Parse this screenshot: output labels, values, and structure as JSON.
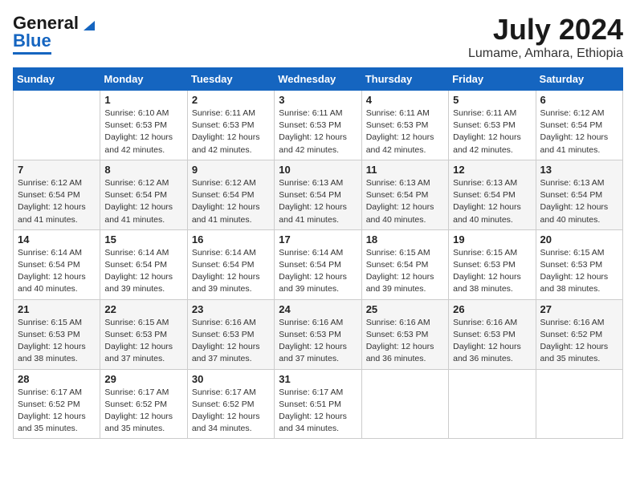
{
  "header": {
    "logo_line1": "General",
    "logo_line2": "Blue",
    "month_title": "July 2024",
    "location": "Lumame, Amhara, Ethiopia"
  },
  "days_of_week": [
    "Sunday",
    "Monday",
    "Tuesday",
    "Wednesday",
    "Thursday",
    "Friday",
    "Saturday"
  ],
  "weeks": [
    [
      {
        "day": "",
        "sunrise": "",
        "sunset": "",
        "daylight": ""
      },
      {
        "day": "1",
        "sunrise": "Sunrise: 6:10 AM",
        "sunset": "Sunset: 6:53 PM",
        "daylight": "Daylight: 12 hours and 42 minutes."
      },
      {
        "day": "2",
        "sunrise": "Sunrise: 6:11 AM",
        "sunset": "Sunset: 6:53 PM",
        "daylight": "Daylight: 12 hours and 42 minutes."
      },
      {
        "day": "3",
        "sunrise": "Sunrise: 6:11 AM",
        "sunset": "Sunset: 6:53 PM",
        "daylight": "Daylight: 12 hours and 42 minutes."
      },
      {
        "day": "4",
        "sunrise": "Sunrise: 6:11 AM",
        "sunset": "Sunset: 6:53 PM",
        "daylight": "Daylight: 12 hours and 42 minutes."
      },
      {
        "day": "5",
        "sunrise": "Sunrise: 6:11 AM",
        "sunset": "Sunset: 6:53 PM",
        "daylight": "Daylight: 12 hours and 42 minutes."
      },
      {
        "day": "6",
        "sunrise": "Sunrise: 6:12 AM",
        "sunset": "Sunset: 6:54 PM",
        "daylight": "Daylight: 12 hours and 41 minutes."
      }
    ],
    [
      {
        "day": "7",
        "sunrise": "Sunrise: 6:12 AM",
        "sunset": "Sunset: 6:54 PM",
        "daylight": "Daylight: 12 hours and 41 minutes."
      },
      {
        "day": "8",
        "sunrise": "Sunrise: 6:12 AM",
        "sunset": "Sunset: 6:54 PM",
        "daylight": "Daylight: 12 hours and 41 minutes."
      },
      {
        "day": "9",
        "sunrise": "Sunrise: 6:12 AM",
        "sunset": "Sunset: 6:54 PM",
        "daylight": "Daylight: 12 hours and 41 minutes."
      },
      {
        "day": "10",
        "sunrise": "Sunrise: 6:13 AM",
        "sunset": "Sunset: 6:54 PM",
        "daylight": "Daylight: 12 hours and 41 minutes."
      },
      {
        "day": "11",
        "sunrise": "Sunrise: 6:13 AM",
        "sunset": "Sunset: 6:54 PM",
        "daylight": "Daylight: 12 hours and 40 minutes."
      },
      {
        "day": "12",
        "sunrise": "Sunrise: 6:13 AM",
        "sunset": "Sunset: 6:54 PM",
        "daylight": "Daylight: 12 hours and 40 minutes."
      },
      {
        "day": "13",
        "sunrise": "Sunrise: 6:13 AM",
        "sunset": "Sunset: 6:54 PM",
        "daylight": "Daylight: 12 hours and 40 minutes."
      }
    ],
    [
      {
        "day": "14",
        "sunrise": "Sunrise: 6:14 AM",
        "sunset": "Sunset: 6:54 PM",
        "daylight": "Daylight: 12 hours and 40 minutes."
      },
      {
        "day": "15",
        "sunrise": "Sunrise: 6:14 AM",
        "sunset": "Sunset: 6:54 PM",
        "daylight": "Daylight: 12 hours and 39 minutes."
      },
      {
        "day": "16",
        "sunrise": "Sunrise: 6:14 AM",
        "sunset": "Sunset: 6:54 PM",
        "daylight": "Daylight: 12 hours and 39 minutes."
      },
      {
        "day": "17",
        "sunrise": "Sunrise: 6:14 AM",
        "sunset": "Sunset: 6:54 PM",
        "daylight": "Daylight: 12 hours and 39 minutes."
      },
      {
        "day": "18",
        "sunrise": "Sunrise: 6:15 AM",
        "sunset": "Sunset: 6:54 PM",
        "daylight": "Daylight: 12 hours and 39 minutes."
      },
      {
        "day": "19",
        "sunrise": "Sunrise: 6:15 AM",
        "sunset": "Sunset: 6:53 PM",
        "daylight": "Daylight: 12 hours and 38 minutes."
      },
      {
        "day": "20",
        "sunrise": "Sunrise: 6:15 AM",
        "sunset": "Sunset: 6:53 PM",
        "daylight": "Daylight: 12 hours and 38 minutes."
      }
    ],
    [
      {
        "day": "21",
        "sunrise": "Sunrise: 6:15 AM",
        "sunset": "Sunset: 6:53 PM",
        "daylight": "Daylight: 12 hours and 38 minutes."
      },
      {
        "day": "22",
        "sunrise": "Sunrise: 6:15 AM",
        "sunset": "Sunset: 6:53 PM",
        "daylight": "Daylight: 12 hours and 37 minutes."
      },
      {
        "day": "23",
        "sunrise": "Sunrise: 6:16 AM",
        "sunset": "Sunset: 6:53 PM",
        "daylight": "Daylight: 12 hours and 37 minutes."
      },
      {
        "day": "24",
        "sunrise": "Sunrise: 6:16 AM",
        "sunset": "Sunset: 6:53 PM",
        "daylight": "Daylight: 12 hours and 37 minutes."
      },
      {
        "day": "25",
        "sunrise": "Sunrise: 6:16 AM",
        "sunset": "Sunset: 6:53 PM",
        "daylight": "Daylight: 12 hours and 36 minutes."
      },
      {
        "day": "26",
        "sunrise": "Sunrise: 6:16 AM",
        "sunset": "Sunset: 6:53 PM",
        "daylight": "Daylight: 12 hours and 36 minutes."
      },
      {
        "day": "27",
        "sunrise": "Sunrise: 6:16 AM",
        "sunset": "Sunset: 6:52 PM",
        "daylight": "Daylight: 12 hours and 35 minutes."
      }
    ],
    [
      {
        "day": "28",
        "sunrise": "Sunrise: 6:17 AM",
        "sunset": "Sunset: 6:52 PM",
        "daylight": "Daylight: 12 hours and 35 minutes."
      },
      {
        "day": "29",
        "sunrise": "Sunrise: 6:17 AM",
        "sunset": "Sunset: 6:52 PM",
        "daylight": "Daylight: 12 hours and 35 minutes."
      },
      {
        "day": "30",
        "sunrise": "Sunrise: 6:17 AM",
        "sunset": "Sunset: 6:52 PM",
        "daylight": "Daylight: 12 hours and 34 minutes."
      },
      {
        "day": "31",
        "sunrise": "Sunrise: 6:17 AM",
        "sunset": "Sunset: 6:51 PM",
        "daylight": "Daylight: 12 hours and 34 minutes."
      },
      {
        "day": "",
        "sunrise": "",
        "sunset": "",
        "daylight": ""
      },
      {
        "day": "",
        "sunrise": "",
        "sunset": "",
        "daylight": ""
      },
      {
        "day": "",
        "sunrise": "",
        "sunset": "",
        "daylight": ""
      }
    ]
  ]
}
